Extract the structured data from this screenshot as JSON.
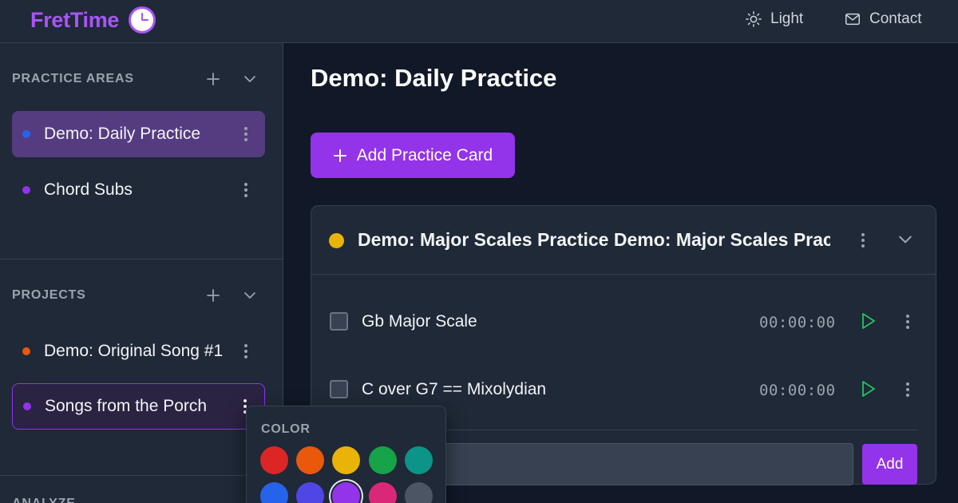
{
  "app": {
    "name": "FretTime"
  },
  "topbar": {
    "light_label": "Light",
    "contact_label": "Contact"
  },
  "sidebar": {
    "practice_areas": {
      "title": "PRACTICE AREAS",
      "items": [
        {
          "label": "Demo: Daily Practice",
          "color": "#2563eb",
          "active": true
        },
        {
          "label": "Chord Subs",
          "color": "#9333ea"
        }
      ]
    },
    "projects": {
      "title": "PROJECTS",
      "items": [
        {
          "label": "Demo: Original Song #1",
          "color": "#ea580c"
        },
        {
          "label": "Songs from the Porch",
          "color": "#9333ea"
        }
      ]
    },
    "analyze": {
      "title": "ANALYZE"
    }
  },
  "main": {
    "title": "Demo: Daily Practice",
    "add_card_label": "Add Practice Card",
    "card": {
      "title": "Demo: Major Scales Practice Demo: Major Scales Practice",
      "color": "#eab308",
      "items": [
        {
          "label": "Gb Major Scale",
          "timer": "00:00:00"
        },
        {
          "label": "C over G7 == Mixolydian",
          "timer": "00:00:00"
        }
      ],
      "new_item_value": "",
      "add_label": "Add"
    }
  },
  "color_popover": {
    "title": "COLOR",
    "swatches": [
      "#dc2626",
      "#ea580c",
      "#eab308",
      "#16a34a",
      "#0d9488",
      "#2563eb",
      "#4f46e5",
      "#9333ea",
      "#db2777",
      "#4b5563"
    ],
    "selected": "#9333ea"
  }
}
